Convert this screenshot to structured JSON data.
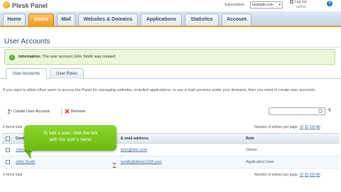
{
  "header": {
    "logo_text": "Plesk Panel",
    "subscription_label": "Subscription:",
    "subscription_value": "example.com",
    "logout_label": "Log out",
    "logout_hint": "admin"
  },
  "nav": {
    "tabs": [
      {
        "label": "Home",
        "active": false
      },
      {
        "label": "Users",
        "active": true
      },
      {
        "label": "Mail",
        "active": false
      },
      {
        "label": "Websites & Domains",
        "active": false
      },
      {
        "label": "Applications",
        "active": false
      },
      {
        "label": "Statistics",
        "active": false
      },
      {
        "label": "Account",
        "active": false
      }
    ]
  },
  "page": {
    "title": "User Accounts",
    "info_bold": "Information:",
    "info_text": "The user account John Smith was created."
  },
  "subtabs": [
    {
      "label": "User Accounts",
      "active": true
    },
    {
      "label": "User Roles",
      "active": false
    }
  ],
  "description": "If you want to allow other users to access the Panel for managing websites, installed applications, or use e-mail services under your domains, then you need to create user accounts.",
  "toolbar": {
    "create_label": "Create User Account",
    "remove_label": "Remove"
  },
  "meta": {
    "items_total_top": "2 items total",
    "items_total_bottom": "2 items total",
    "entries_label": "Number of entries per page:",
    "entries_options": [
      "10",
      "25",
      "100",
      "All"
    ]
  },
  "table": {
    "columns": [
      "Contact name",
      "E-mail address",
      "Role"
    ],
    "rows": [
      {
        "name": "John Doe",
        "email": "john@doe.com",
        "role": "Owner"
      },
      {
        "name": "John Smith",
        "email": "jsmith@demo1234.com",
        "role": "Application User"
      }
    ]
  },
  "tooltip": {
    "line1": "To edit a user, click the link",
    "line2": "with the user's name"
  },
  "colors": {
    "accent": "#f39a1c",
    "tooltip": "#6cbb12",
    "link": "#2f6ea8",
    "info_bg": "#eaf7d8"
  }
}
